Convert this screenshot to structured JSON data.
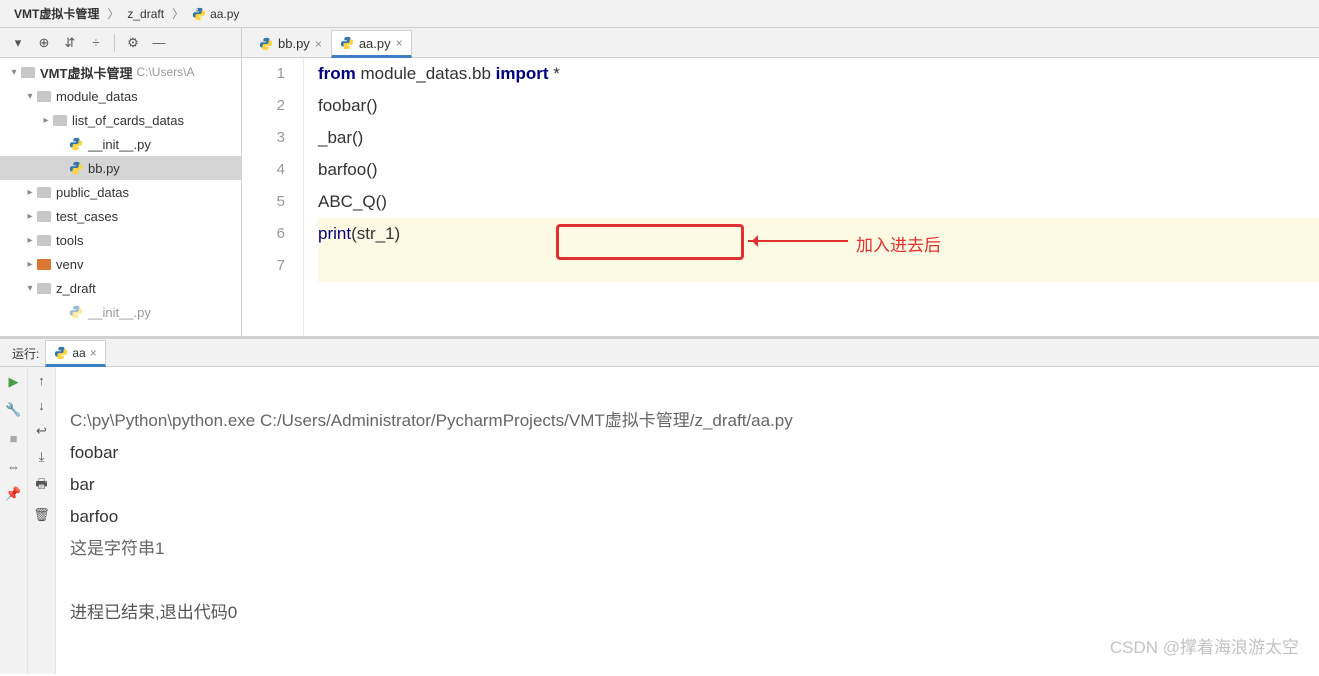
{
  "breadcrumb": {
    "root": "VMT虚拟卡管理",
    "folder": "z_draft",
    "file": "aa.py"
  },
  "tree": {
    "root": {
      "name": "VMT虚拟卡管理",
      "hint": "C:\\Users\\A"
    },
    "module_datas": "module_datas",
    "list_of_cards": "list_of_cards_datas",
    "init": "__init__.py",
    "bb": "bb.py",
    "public_datas": "public_datas",
    "test_cases": "test_cases",
    "tools": "tools",
    "venv": "venv",
    "z_draft": "z_draft",
    "init2": "__init__.py"
  },
  "tabs": {
    "bb": "bb.py",
    "aa": "aa.py"
  },
  "code": {
    "l1_pre": "from ",
    "l1_mod": "module_datas.bb ",
    "l1_imp": "import ",
    "l1_star": "*",
    "l2": "foobar()",
    "l3": "_bar()",
    "l4": "barfoo()",
    "l5": "ABC_Q()",
    "l6_print": "print",
    "l6_arg": "(str_1)"
  },
  "annotation": "加入进去后",
  "run": {
    "label": "运行:",
    "tab": "aa",
    "cmd": "C:\\py\\Python\\python.exe C:/Users/Administrator/PycharmProjects/VMT虚拟卡管理/z_draft/aa.py",
    "out1": "foobar",
    "out2": "bar",
    "out3": "barfoo",
    "out4": "这是字符串1",
    "exit": "进程已结束,退出代码0"
  },
  "watermark": "CSDN @撑着海浪游太空",
  "gutter": {
    "l1": "1",
    "l2": "2",
    "l3": "3",
    "l4": "4",
    "l5": "5",
    "l6": "6",
    "l7": "7"
  }
}
